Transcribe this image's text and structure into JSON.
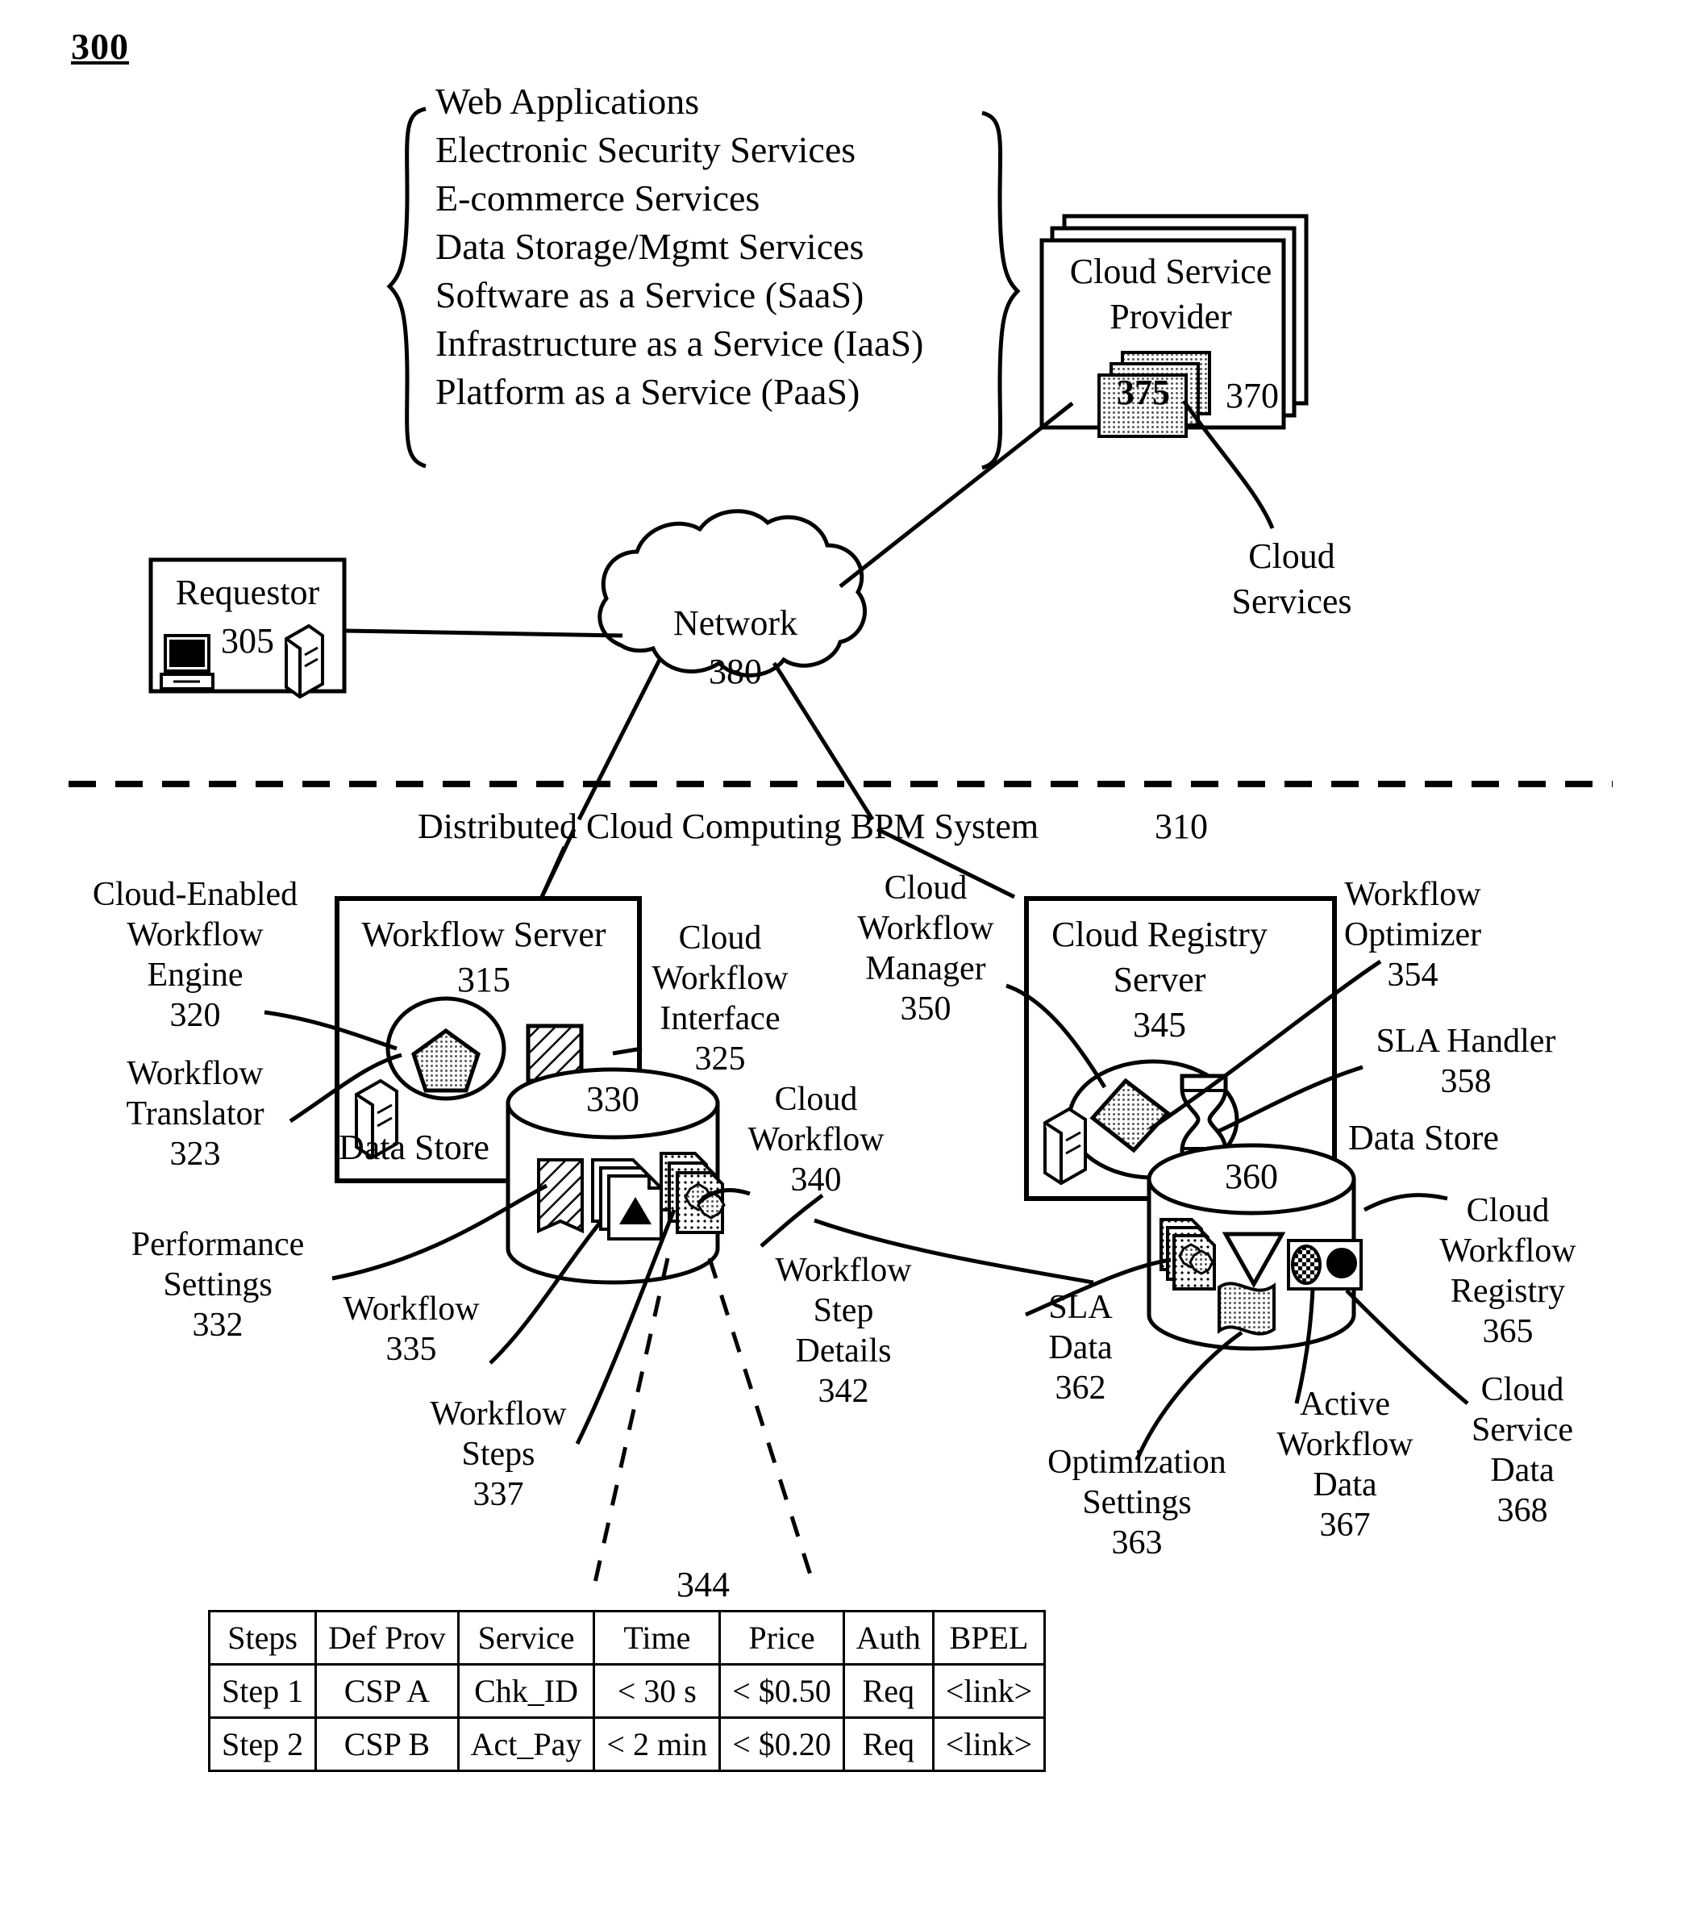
{
  "figure": {
    "number": "300"
  },
  "service_list": {
    "items": [
      "Web Applications",
      "Electronic Security Services",
      "E-commerce Services",
      "Data Storage/Mgmt Services",
      "Software as a Service (SaaS)",
      "Infrastructure as a Service (IaaS)",
      "Platform as a Service (PaaS)"
    ]
  },
  "cloud_service_provider": {
    "title_line1": "Cloud Service",
    "title_line2": "Provider",
    "ref": "370",
    "inner_ref": "375",
    "callout_line1": "Cloud",
    "callout_line2": "Services"
  },
  "requestor": {
    "label": "Requestor",
    "ref": "305"
  },
  "network": {
    "label": "Network",
    "ref": "380"
  },
  "system": {
    "label": "Distributed Cloud Computing BPM System",
    "ref": "310"
  },
  "workflow_server": {
    "title": "Workflow Server",
    "ref": "315",
    "data_store_label": "Data Store",
    "data_store_ref": "330"
  },
  "registry_server": {
    "title_line1": "Cloud Registry",
    "title_line2": "Server",
    "ref": "345",
    "data_store_label": "Data Store",
    "data_store_ref": "360"
  },
  "left_callouts": [
    {
      "lines": [
        "Cloud-Enabled",
        "Workflow",
        "Engine"
      ],
      "ref": "320"
    },
    {
      "lines": [
        "Workflow",
        "Translator"
      ],
      "ref": "323"
    },
    {
      "lines": [
        "Performance",
        "Settings"
      ],
      "ref": "332"
    },
    {
      "lines": [
        "Workflow"
      ],
      "ref": "335"
    },
    {
      "lines": [
        "Workflow",
        "Steps"
      ],
      "ref": "337"
    }
  ],
  "mid_callouts": [
    {
      "lines": [
        "Cloud",
        "Workflow",
        "Interface"
      ],
      "ref": "325"
    },
    {
      "lines": [
        "Cloud",
        "Workflow"
      ],
      "ref": "340"
    },
    {
      "lines": [
        "Workflow",
        "Step",
        "Details"
      ],
      "ref": "342"
    },
    {
      "lines": [
        "Cloud",
        "Workflow",
        "Manager"
      ],
      "ref": "350"
    }
  ],
  "right_callouts": [
    {
      "lines": [
        "Workflow",
        "Optimizer"
      ],
      "ref": "354"
    },
    {
      "lines": [
        "SLA Handler"
      ],
      "ref": "358"
    },
    {
      "lines": [
        "SLA",
        "Data"
      ],
      "ref": "362"
    },
    {
      "lines": [
        "Optimization",
        "Settings"
      ],
      "ref": "363"
    },
    {
      "lines": [
        "Cloud",
        "Workflow",
        "Registry"
      ],
      "ref": "365"
    },
    {
      "lines": [
        "Active",
        "Workflow",
        "Data"
      ],
      "ref": "367"
    },
    {
      "lines": [
        "Cloud",
        "Service",
        "Data"
      ],
      "ref": "368"
    }
  ],
  "table": {
    "ref": "344",
    "headers": [
      "Steps",
      "Def Prov",
      "Service",
      "Time",
      "Price",
      "Auth",
      "BPEL"
    ],
    "rows": [
      [
        "Step 1",
        "CSP A",
        "Chk_ID",
        "< 30 s",
        "< $0.50",
        "Req",
        "<link>"
      ],
      [
        "Step 2",
        "CSP B",
        "Act_Pay",
        "< 2 min",
        "< $0.20",
        "Req",
        "<link>"
      ]
    ]
  },
  "icons": {
    "workflow_engine": "pentagon-icon",
    "workflow_translator": "server-tower-icon",
    "cloud_workflow_interface": "hatched-square-icon",
    "performance_settings": "hatched-tab-icon",
    "workflow_docs": "document-stack-icon",
    "workflow_steps": "document-with-gear-icon",
    "cloud_workflow_manager": "diamond-icon",
    "sla_handler": "hourglass-icon",
    "sla_data": "document-gear-icon",
    "active_workflow": "triangle-down-icon",
    "optimization_settings": "wavy-flag-icon",
    "cloud_workflow_registry": "registry-box-icon",
    "requestor_devices": "desktop-and-tower-icon",
    "network": "cloud-shape-icon",
    "csp_stack": "stacked-pages-icon"
  },
  "colors": {
    "line": "#000000",
    "fill_gray": "#b8b8b8",
    "background": "#ffffff"
  }
}
